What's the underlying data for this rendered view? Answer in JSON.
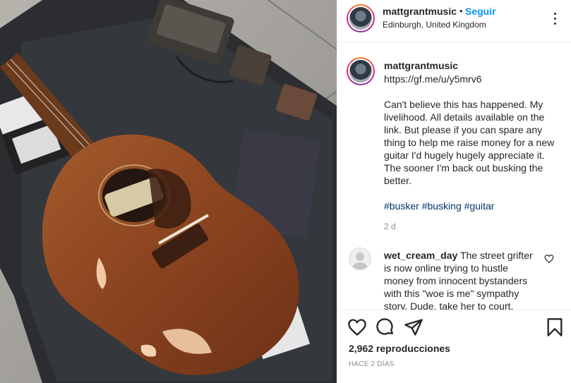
{
  "media": {
    "description_icons": [
      "guitar",
      "pedal-board"
    ]
  },
  "header": {
    "username": "mattgrantmusic",
    "separator": "•",
    "follow_label": "Seguir",
    "location": "Edinburgh, United Kingdom"
  },
  "caption": {
    "username": "mattgrantmusic",
    "link": "https://gf.me/u/y5mrv6",
    "text": "Can't believe this has happened. My livelihood. All details available on the link. But please if you can spare any thing to help me raise money for a new guitar I'd hugely hugely appreciate it. The sooner I'm back out busking the better.",
    "hashtags": [
      "#busker",
      "#busking",
      "#guitar"
    ],
    "time": "2 d"
  },
  "comments": [
    {
      "username": "wet_cream_day",
      "text": "The street grifter is now online trying to hustle money from innocent bystanders with this \"woe is me\" sympathy story. Dude, take her to court."
    }
  ],
  "actions": {
    "views": "2,962 reproducciones",
    "date": "HACE 2 DÍAS"
  },
  "colors": {
    "link_blue": "#0095f6",
    "hashtag_blue": "#00376b",
    "muted": "#8e8e8e"
  }
}
